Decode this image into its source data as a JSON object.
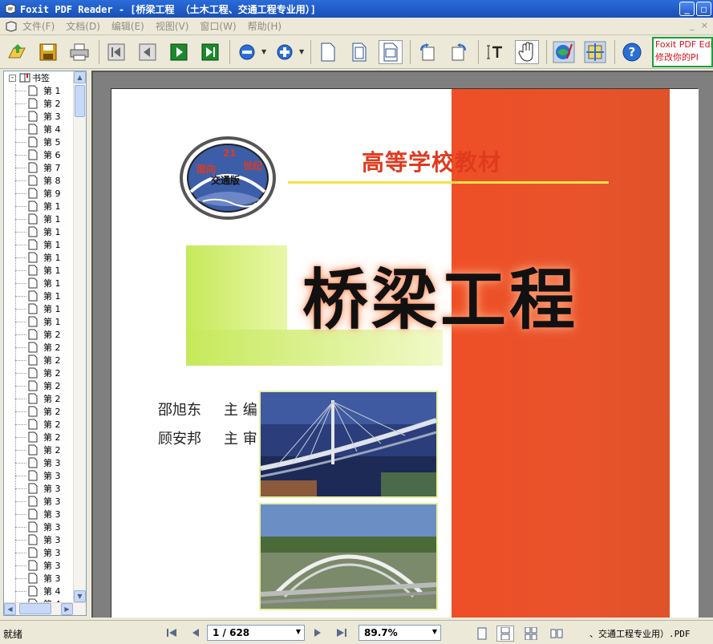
{
  "window": {
    "title": "Foxit PDF Reader - [桥梁工程  （土木工程、交通工程专业用）]",
    "minimize_glyph": "_",
    "maximize_glyph": "□"
  },
  "menu": {
    "items": [
      "文件(F)",
      "文档(D)",
      "编辑(E)",
      "视图(V)",
      "窗口(W)",
      "帮助(H)"
    ],
    "right_controls": [
      "_",
      "×"
    ]
  },
  "toolbar": {
    "tools": [
      {
        "name": "open-icon"
      },
      {
        "name": "save-icon"
      },
      {
        "name": "print-icon"
      },
      {
        "name": "first-page-icon"
      },
      {
        "name": "prev-page-icon"
      },
      {
        "name": "next-page-icon"
      },
      {
        "name": "last-page-icon"
      },
      {
        "name": "zoom-out-icon"
      },
      {
        "name": "zoom-in-icon"
      },
      {
        "name": "actual-size-icon"
      },
      {
        "name": "fit-page-icon"
      },
      {
        "name": "fit-width-icon"
      },
      {
        "name": "rotate-left-icon"
      },
      {
        "name": "rotate-right-icon"
      },
      {
        "name": "text-select-icon"
      },
      {
        "name": "hand-tool-icon"
      },
      {
        "name": "web-icon"
      },
      {
        "name": "snapshot-icon"
      },
      {
        "name": "help-icon"
      }
    ],
    "ad_line1": "Foxit PDF Edi",
    "ad_line2": "修改你的PI"
  },
  "sidebar": {
    "root_label": "书签",
    "items": [
      "第 1",
      "第 2",
      "第 3",
      "第 4",
      "第 5",
      "第 6",
      "第 7",
      "第 8",
      "第 9",
      "第 1",
      "第 1",
      "第 1",
      "第 1",
      "第 1",
      "第 1",
      "第 1",
      "第 1",
      "第 1",
      "第 1",
      "第 2",
      "第 2",
      "第 2",
      "第 2",
      "第 2",
      "第 2",
      "第 2",
      "第 2",
      "第 2",
      "第 2",
      "第 3",
      "第 3",
      "第 3",
      "第 3",
      "第 3",
      "第 3",
      "第 3",
      "第 3",
      "第 3",
      "第 3",
      "第 4",
      "第 4"
    ]
  },
  "document": {
    "logo_top": "面向",
    "logo_21": "21",
    "logo_right": "世纪",
    "logo_edition": "交通版",
    "series": "高等学校教材",
    "title": "桥梁工程",
    "author_name": "邵旭东",
    "author_role": "主  编",
    "reviewer_name": "顾安邦",
    "reviewer_role": "主  审"
  },
  "status": {
    "text": "就绪",
    "page": "1 / 628",
    "zoom": "89.7%",
    "file": "、交通工程专业用）.PDF"
  },
  "colors": {
    "cover_orange": "#e8532c",
    "cover_green": "#c6e95a",
    "title_red": "#e03a1e",
    "xp_blue": "#1a4fb8"
  }
}
